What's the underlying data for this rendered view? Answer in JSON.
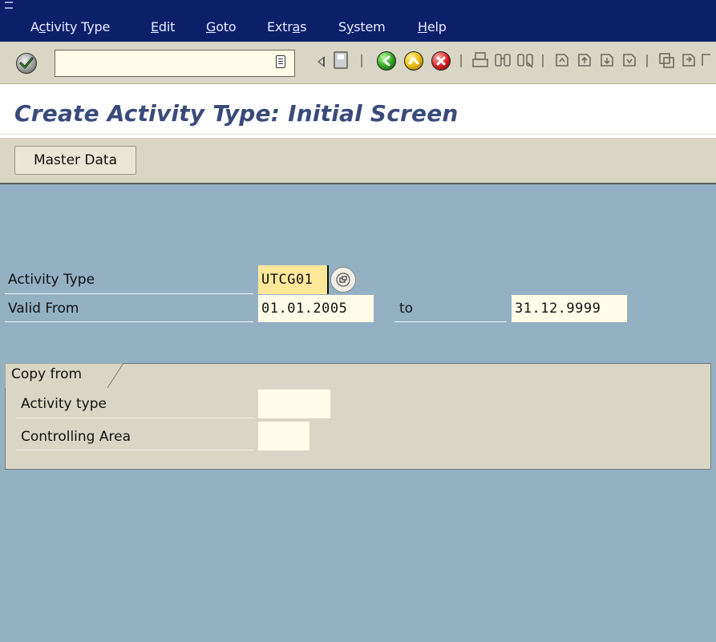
{
  "menu": {
    "items": [
      {
        "pre": "A",
        "acc": "c",
        "post": "tivity Type"
      },
      {
        "pre": "",
        "acc": "E",
        "post": "dit"
      },
      {
        "pre": "",
        "acc": "G",
        "post": "oto"
      },
      {
        "pre": "Extr",
        "acc": "a",
        "post": "s"
      },
      {
        "pre": "S",
        "acc": "y",
        "post": "stem"
      },
      {
        "pre": "",
        "acc": "H",
        "post": "elp"
      }
    ]
  },
  "toolbar": {
    "command_value": ""
  },
  "title": "Create Activity Type: Initial Screen",
  "app_toolbar": {
    "master_data_label": "Master Data"
  },
  "form": {
    "activity_type_label": "Activity Type",
    "activity_type_value": "UTCG01",
    "valid_from_label": "Valid From",
    "valid_from_value": "01.01.2005",
    "to_label": "to",
    "valid_to_value": "31.12.9999"
  },
  "copy_from": {
    "title": "Copy from",
    "activity_type_label": "Activity type",
    "activity_type_value": "",
    "controlling_area_label": "Controlling Area",
    "controlling_area_value": ""
  },
  "colors": {
    "menubar": "#0c1f6b",
    "toolbar": "#d9d6c6",
    "main_bg": "#94b1c3",
    "title": "#3a4a7a",
    "required_field": "#ffe79a",
    "input_field": "#fffde8"
  }
}
